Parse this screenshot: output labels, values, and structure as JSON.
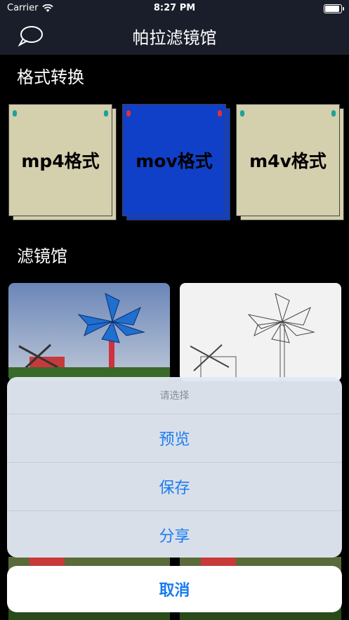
{
  "status_bar": {
    "carrier": "Carrier",
    "time": "8:27 PM",
    "battery_level": 1.0
  },
  "nav": {
    "title": "帕拉滤镜馆",
    "chat_icon": "chat-bubble-icon"
  },
  "sections": {
    "format_title": "格式转换",
    "filter_title": "滤镜馆"
  },
  "formats": [
    {
      "label": "mp4格式",
      "card_color": "#d4cfad",
      "pin_color": "#19a39a"
    },
    {
      "label": "mov格式",
      "card_color": "#1040c8",
      "pin_color": "#e03030"
    },
    {
      "label": "m4v格式",
      "card_color": "#d4cfad",
      "pin_color": "#19a39a"
    }
  ],
  "filters": [
    {
      "name": "color-poster",
      "style": "color"
    },
    {
      "name": "pencil-sketch",
      "style": "sketch"
    }
  ],
  "action_sheet": {
    "title": "请选择",
    "options": [
      "预览",
      "保存",
      "分享"
    ],
    "cancel": "取消"
  }
}
